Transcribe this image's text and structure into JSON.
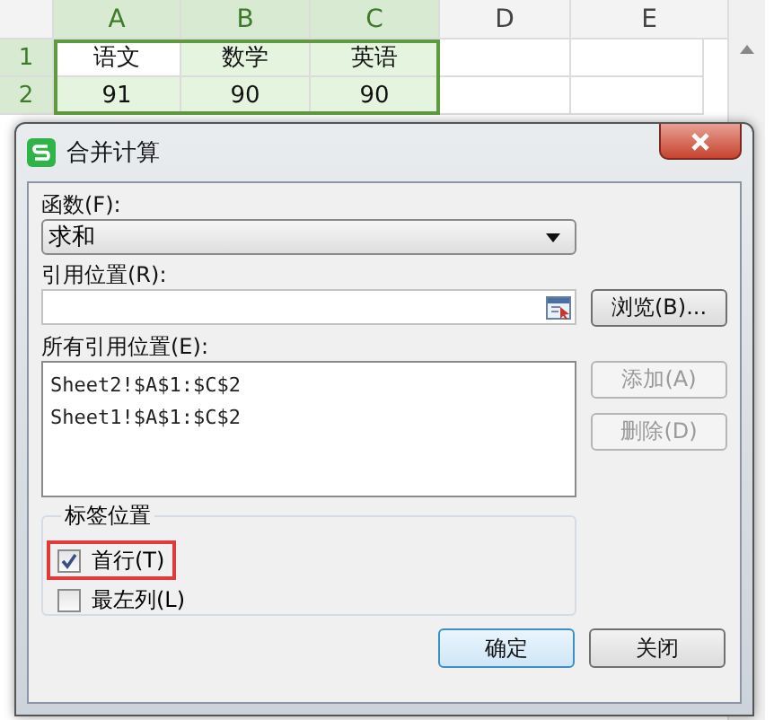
{
  "sheet": {
    "columns": [
      {
        "label": "A",
        "selected": true
      },
      {
        "label": "B",
        "selected": true
      },
      {
        "label": "C",
        "selected": true
      },
      {
        "label": "D",
        "selected": false
      },
      {
        "label": "E",
        "selected": false
      }
    ],
    "rows": [
      {
        "number": "1",
        "selected": true,
        "cells": [
          "语文",
          "数学",
          "英语"
        ]
      },
      {
        "number": "2",
        "selected": true,
        "cells": [
          "91",
          "90",
          "90"
        ]
      }
    ]
  },
  "dialog": {
    "title": "合并计算",
    "function_label": "函数(F):",
    "function_value": "求和",
    "reference_label": "引用位置(R):",
    "browse_button": "浏览(B)...",
    "all_references_label": "所有引用位置(E):",
    "all_references": [
      "Sheet2!$A$1:$C$2",
      "Sheet1!$A$1:$C$2"
    ],
    "side_buttons": [
      {
        "label": "添加(A)",
        "disabled": true
      },
      {
        "label": "删除(D)",
        "disabled": true
      }
    ],
    "label_group": {
      "title": "标签位置",
      "options": [
        {
          "label": "首行(T)",
          "checked": true,
          "highlighted": true
        },
        {
          "label": "最左列(L)",
          "checked": false,
          "highlighted": false
        }
      ]
    },
    "buttons": [
      {
        "label": "确定",
        "default": true
      },
      {
        "label": "关闭",
        "default": false
      }
    ]
  }
}
